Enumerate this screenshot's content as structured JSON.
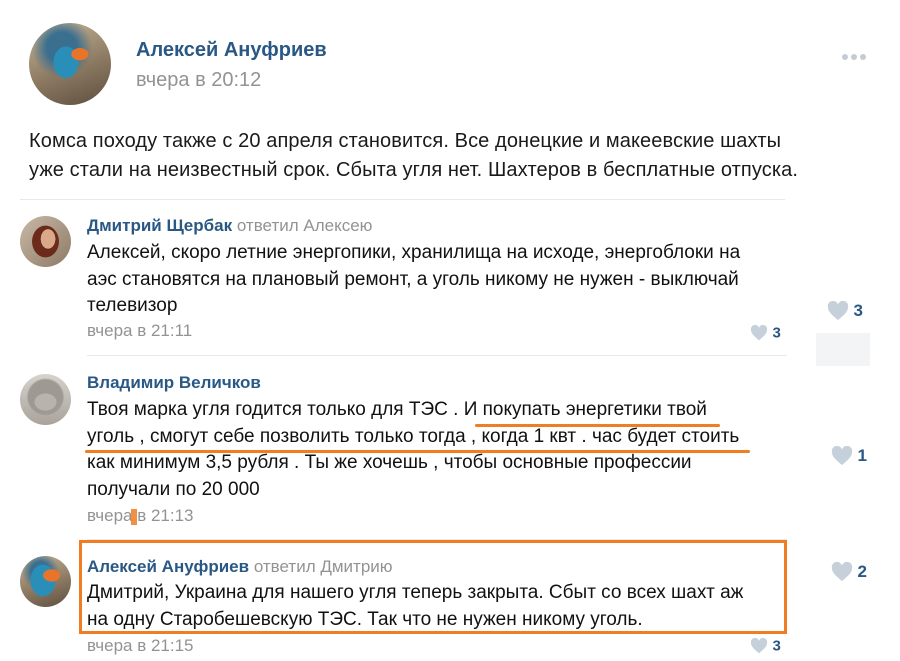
{
  "post": {
    "author": "Алексей Ануфриев",
    "time": "вчера в 20:12",
    "text_lines": [
      "Комса походу также с 20 апреля становится. Все донецкие и макеевские шахты",
      "уже стали на неизвестный срок. Сбыта угля нет. Шахтеров в бесплатные отпуска."
    ]
  },
  "comments": [
    {
      "author": "Дмитрий Щербак",
      "reply": "ответил Алексею",
      "lines": [
        "Алексей, скоро летние энергопики, хранилища на исходе, энергоблоки на",
        "аэс становятся на плановый ремонт, а уголь никому не нужен - выключай",
        "телевизор"
      ],
      "time": "вчера в 21:11",
      "likes_small": "3",
      "likes_side": "3"
    },
    {
      "author": "Владимир Величков",
      "reply": "",
      "lines": [
        "Твоя марка угля годится только для ТЭС . И покупать энергетики твой",
        "уголь , смогут себе позволить только тогда , когда 1 квт . час будет стоить",
        "как минимум 3,5 рубля . Ты же хочешь , чтобы основные профессии",
        "получали по 20 000"
      ],
      "time": "вчера в 21:13",
      "likes_side": "1"
    },
    {
      "author": "Алексей Ануфриев",
      "reply": "ответил Дмитрию",
      "lines": [
        "Дмитрий, Украина для нашего угля теперь закрыта. Сбыт со всех шахт аж",
        "на одну Старобешевскую ТЭС. Так что не нужен никому уголь."
      ],
      "time": "вчера в 21:15",
      "likes_small": "3",
      "likes_side": "2"
    }
  ],
  "colors": {
    "link": "#2a5885",
    "meta": "#939393",
    "heart": "#c5d0db",
    "annotation": "#f07d22"
  }
}
